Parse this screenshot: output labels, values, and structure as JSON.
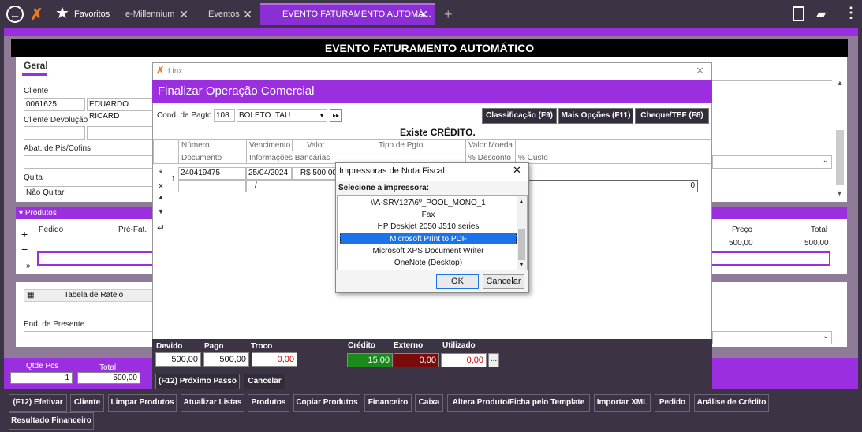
{
  "topbar": {
    "favorites": "Favoritos",
    "tabs": [
      "e-Millennium",
      "Eventos",
      "EVENTO FATURAMENTO AUTOMÁ..."
    ]
  },
  "page": {
    "title": "EVENTO FATURAMENTO AUTOMÁTICO",
    "tab_geral": "Geral"
  },
  "form": {
    "cliente_label": "Cliente",
    "cliente_code": "0061625",
    "cliente_name": "EDUARDO RICARD",
    "devolucao_label": "Cliente Devolução",
    "abat_label": "Abat. de Pis/Cofins",
    "quita_label": "Quita",
    "quita_value": "Não Quitar"
  },
  "produtos": {
    "header": "Produtos",
    "cols": [
      "Pedido",
      "Pré-Fat.",
      "Preço",
      "Total"
    ],
    "preco": "500,00",
    "total": "500,00"
  },
  "rateio": {
    "button": "Tabela de Rateio",
    "presente_label": "End. de Presente"
  },
  "totals": {
    "qtde_label": "Qtde Pcs",
    "total_label": "Total",
    "qtde": "1",
    "total": "500,00"
  },
  "bottom_buttons": [
    "(F12) Efetivar",
    "Cliente",
    "Limpar Produtos",
    "Atualizar Listas",
    "Produtos",
    "Copiar Produtos",
    "Financeiro",
    "Caixa",
    "Altera Produto/Ficha pelo Template",
    "Importar XML",
    "Pedido",
    "Análise de Crédito",
    "Resultado Financeiro"
  ],
  "dialog": {
    "app": "Linx",
    "title": "Finalizar Operação Comercial",
    "cond_label": "Cond. de Pagto",
    "cond_code": "108",
    "cond_value": "BOLETO ITAU",
    "btn_class": "Classificação (F9)",
    "btn_mais": "Mais Opções (F11)",
    "btn_cheque": "Cheque/TEF (F8)",
    "credito": "Existe CRÉDITO.",
    "cols1": [
      "Número",
      "Vencimento",
      "Valor",
      "Tipo de Pgto.",
      "Valor Moeda"
    ],
    "cols2": [
      "Documento",
      "Informações Bancárias",
      "% Desconto",
      "% Custo"
    ],
    "row": {
      "idx": "1",
      "numero": "240419475",
      "venc": "25/04/2024",
      "valor": "R$ 500,00",
      "slash": "/",
      "zero": "0"
    },
    "foot": {
      "devido_l": "Devido",
      "pago_l": "Pago",
      "troco_l": "Troco",
      "credito_l": "Crédito",
      "externo_l": "Externo",
      "utilizado_l": "Utilizado",
      "devido": "500,00",
      "pago": "500,00",
      "troco": "0,00",
      "credito": "15,00",
      "externo": "0,00",
      "utilizado": "0,00",
      "more": "...",
      "btn_next": "(F12) Próximo Passo",
      "btn_cancel": "Cancelar"
    }
  },
  "printer": {
    "title": "Impressoras de Nota Fiscal",
    "prompt": "Selecione a impressora:",
    "items": [
      "\\\\A-SRV127\\6º_POOL_MONO_1",
      "Fax",
      "HP Deskjet 2050 J510 series",
      "Microsoft Print to PDF",
      "Microsoft XPS Document Writer",
      "OneNote (Desktop)"
    ],
    "ok": "OK",
    "cancel": "Cancelar"
  }
}
